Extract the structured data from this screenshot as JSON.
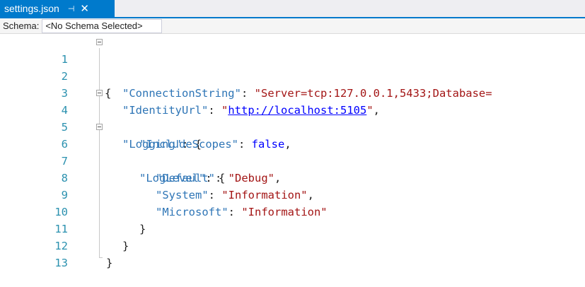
{
  "tab": {
    "title": "settings.json",
    "pin_glyph": "⊣",
    "close_glyph": "✕"
  },
  "schema": {
    "label": "Schema:",
    "value": "<No Schema Selected>"
  },
  "lines": [
    {
      "n": "1"
    },
    {
      "n": "2",
      "key": "\"ConnectionString\"",
      "sep": ": ",
      "val": "\"Server=tcp:127.0.0.1,5433;Database="
    },
    {
      "n": "3",
      "key": "\"IdentityUrl\"",
      "sep": ": ",
      "q1": "\"",
      "url": "http://localhost:5105",
      "q2": "\"",
      "end": ","
    },
    {
      "n": "4",
      "key": "\"Logging\"",
      "sep": ": {"
    },
    {
      "n": "5",
      "key": "\"IncludeScopes\"",
      "sep": ": ",
      "val": "false",
      "end": ","
    },
    {
      "n": "6",
      "key": "\"LogLevel\"",
      "sep": ": {"
    },
    {
      "n": "7",
      "key": "\"Default\"",
      "sep": ": ",
      "val": "\"Debug\"",
      "end": ","
    },
    {
      "n": "8",
      "key": "\"System\"",
      "sep": ": ",
      "val": "\"Information\"",
      "end": ","
    },
    {
      "n": "9",
      "key": "\"Microsoft\"",
      "sep": ": ",
      "val": "\"Information\""
    },
    {
      "n": "10",
      "text": "}"
    },
    {
      "n": "11",
      "text": "}"
    },
    {
      "n": "12",
      "text": "}"
    },
    {
      "n": "13"
    }
  ],
  "open_brace": "{"
}
